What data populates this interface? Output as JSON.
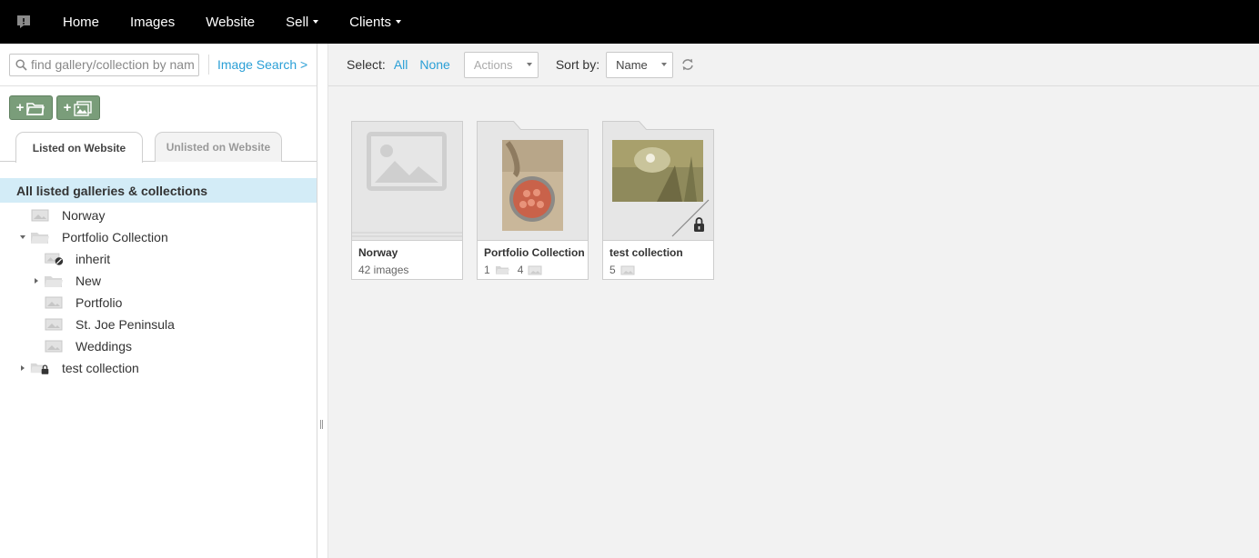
{
  "nav": {
    "items": [
      {
        "label": "Home",
        "has_caret": false
      },
      {
        "label": "Images",
        "has_caret": false
      },
      {
        "label": "Website",
        "has_caret": false
      },
      {
        "label": "Sell",
        "has_caret": true
      },
      {
        "label": "Clients",
        "has_caret": true
      }
    ]
  },
  "sidebar": {
    "search_placeholder": "find gallery/collection by name",
    "image_search_label": "Image Search >",
    "add_collection_label": "+",
    "add_gallery_label": "+",
    "tabs": {
      "listed": "Listed on Website",
      "unlisted": "Unlisted on Website"
    },
    "tree_all_label": "All listed galleries & collections",
    "tree": [
      {
        "label": "Norway",
        "type": "gallery",
        "level": 0,
        "arrow": "none"
      },
      {
        "label": "Portfolio Collection",
        "type": "collection",
        "level": 0,
        "arrow": "down"
      },
      {
        "label": "inherit",
        "type": "gallery-blocked",
        "level": 1,
        "arrow": "none"
      },
      {
        "label": "New",
        "type": "collection",
        "level": 1,
        "arrow": "right"
      },
      {
        "label": "Portfolio",
        "type": "gallery",
        "level": 1,
        "arrow": "none"
      },
      {
        "label": "St. Joe Peninsula",
        "type": "gallery",
        "level": 1,
        "arrow": "none"
      },
      {
        "label": "Weddings",
        "type": "gallery",
        "level": 1,
        "arrow": "none"
      },
      {
        "label": "test collection",
        "type": "collection-locked",
        "level": 0,
        "arrow": "right"
      }
    ]
  },
  "toolbar": {
    "select_label": "Select:",
    "select_all": "All",
    "select_none": "None",
    "actions_label": "Actions",
    "sort_by_label": "Sort by:",
    "sort_value": "Name"
  },
  "cards": [
    {
      "title": "Norway",
      "subtitle": "42 images",
      "kind": "gallery"
    },
    {
      "title": "Portfolio Collection",
      "collections_count": "1",
      "galleries_count": "4",
      "kind": "collection"
    },
    {
      "title": "test collection",
      "galleries_count": "5",
      "kind": "collection-locked"
    }
  ]
}
